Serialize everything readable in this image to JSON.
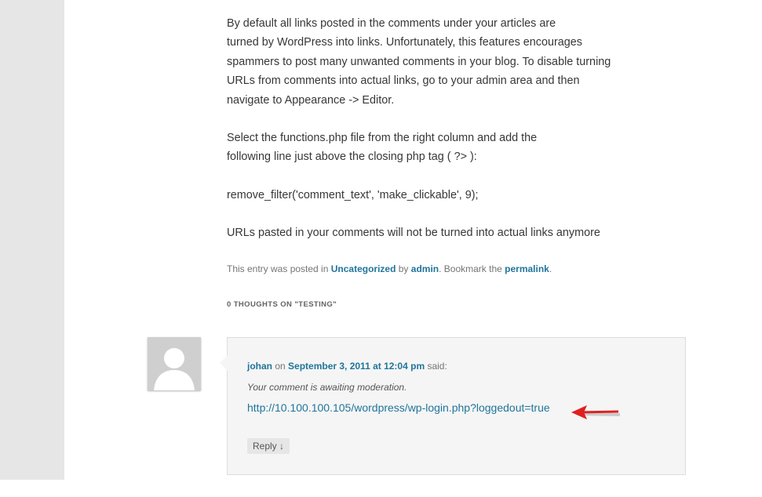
{
  "article": {
    "paragraphs": [
      [
        "By default all links posted in the comments under your articles are",
        "turned by WordPress into links. Unfortunately, this features encourages",
        "spammers to post many unwanted comments in your blog. To disable turning",
        "URLs from comments into actual links, go to your admin area and then",
        "navigate to Appearance -> Editor."
      ],
      [
        "Select the functions.php file from the right column and add the",
        "following line just above the closing php tag ( ?> ):"
      ],
      [
        "remove_filter('comment_text', 'make_clickable', 9);"
      ],
      [
        "URLs pasted in your comments will not be turned into actual links anymore"
      ]
    ]
  },
  "meta": {
    "prefix": "This entry was posted in ",
    "category": "Uncategorized",
    "by_text": " by ",
    "author": "admin",
    "bookmark_text": ". Bookmark the ",
    "permalink": "permalink",
    "end": "."
  },
  "comments_title": "0 THOUGHTS ON \"TESTING\"",
  "comment": {
    "author": "johan",
    "on_text": " on ",
    "date": "September 3, 2011 at 12:04 pm",
    "said_text": " said:",
    "moderation": "Your comment is awaiting moderation.",
    "link": "http://10.100.100.105/wordpress/wp-login.php?loggedout=true",
    "reply": "Reply ↓"
  },
  "colors": {
    "link": "#21759b",
    "arrow": "#e02020",
    "sidebar": "#e6e6e6"
  }
}
